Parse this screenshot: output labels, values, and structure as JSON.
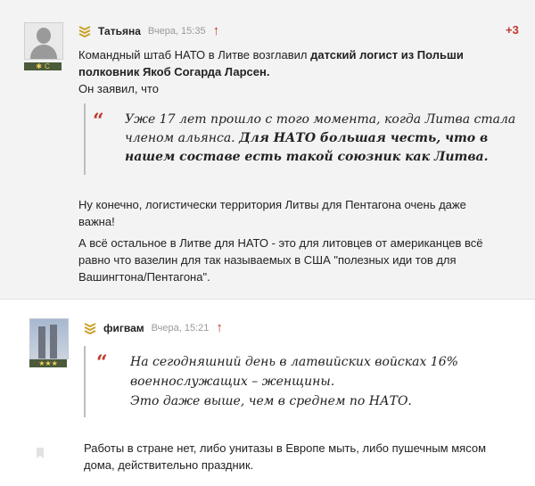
{
  "comments": [
    {
      "author": "Татьяна",
      "time": "Вчера, 15:35",
      "score": "+3",
      "rank_label": "С",
      "intro_plain": "Командный штаб НАТО в Литве возглавил ",
      "intro_bold_1": "датский логист из Польши",
      "intro_bold_2": "полковник Якоб Согарда Ларсен.",
      "said": "Он заявил, что",
      "quote_plain_1": "Уже 17 лет прошло с того момента, когда Литва стала",
      "quote_plain_2": "членом альянса. ",
      "quote_bold_1": "Для НАТО большая честь, что в",
      "quote_bold_2": "нашем составе есть такой союзник как Литва.",
      "para1_line1": "Ну конечно, логистически территория Литвы для Пентагона очень даже",
      "para1_line2": "важна!",
      "para2_line1": "А всё остальное в Литве для НАТО - это для литовцев от американцев всё",
      "para2_line2": "равно что вазелин для так называемых в США \"полезных иди тов для",
      "para2_line3": "Вашингтона/Пентагона\"."
    },
    {
      "author": "фигвам",
      "time": "Вчера, 15:21",
      "rank_label": "★★★",
      "quote_line1": "На сегодняшний день в латвийских войсках 16%",
      "quote_line2": "военнослужащих – женщины.",
      "quote_line3": "Это даже выше, чем в среднем по НАТО.",
      "text_line1": "Работы в стране нет, либо унитазы в Европе мыть, либо пушечным мясом",
      "text_line2": "дома, действительно праздник."
    }
  ],
  "icons": {
    "rank": "chevron-rank-icon",
    "upvote": "arrow-up-icon",
    "quote": "quote-mark-icon",
    "bookmark": "bookmark-icon"
  },
  "colors": {
    "accent": "#c0392b",
    "rank_gold": "#c9a227",
    "rank_bar": "#4a5a3a"
  }
}
